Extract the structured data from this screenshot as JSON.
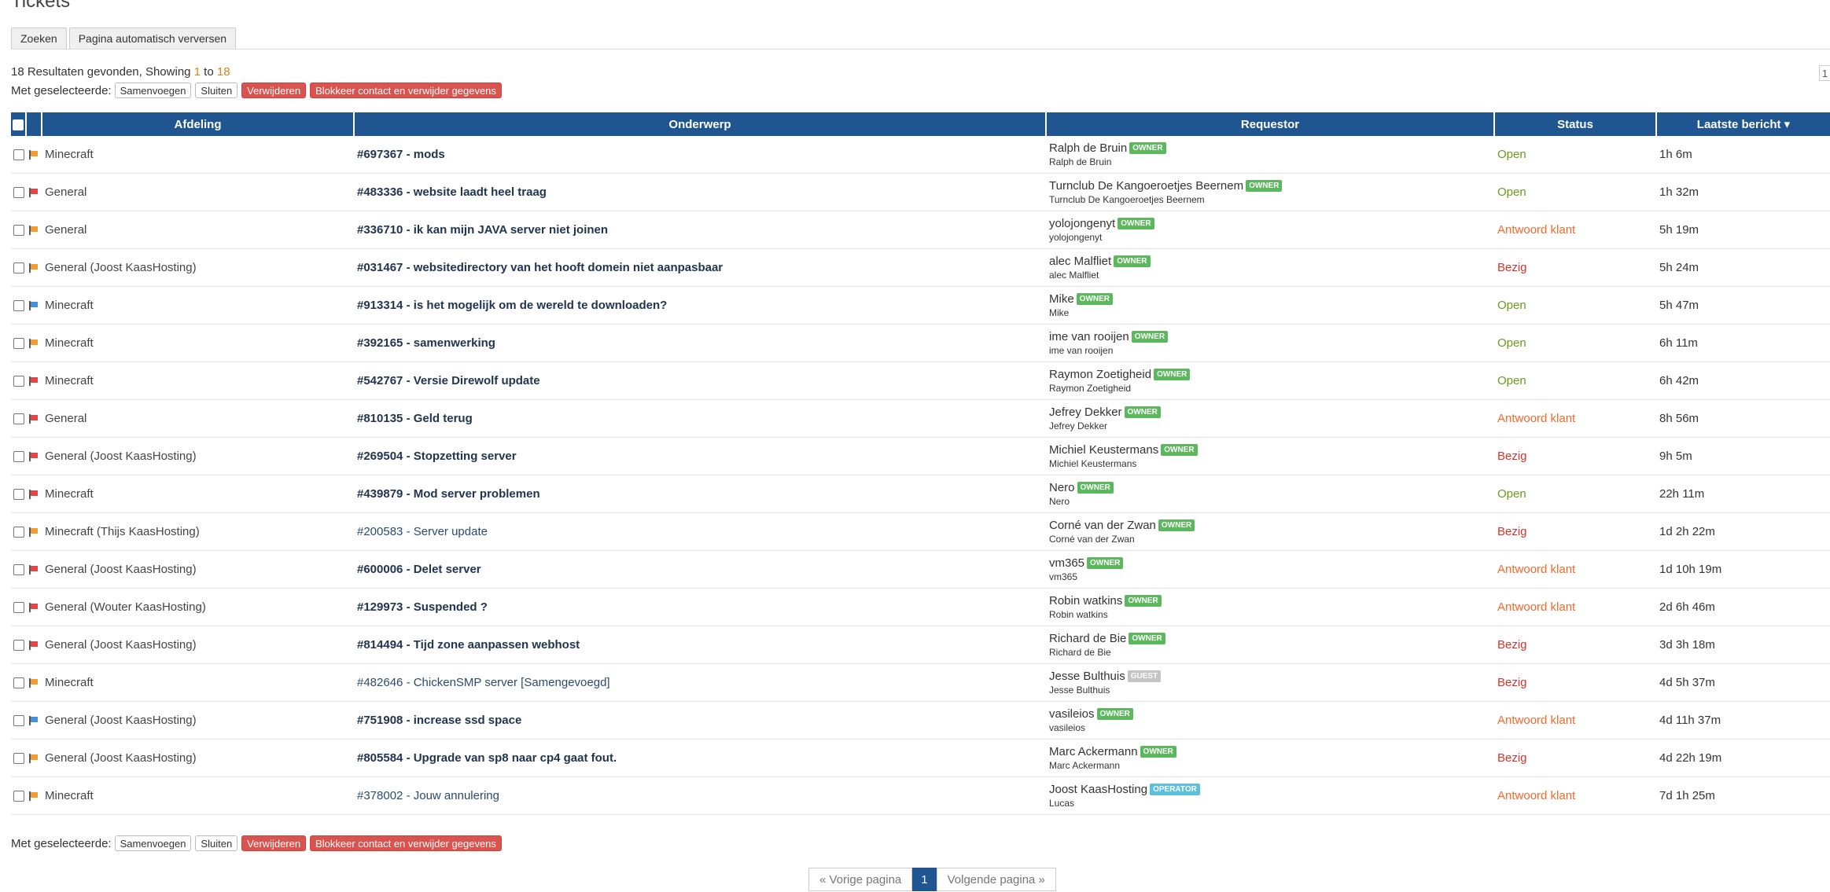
{
  "page": {
    "title": "Tickets"
  },
  "tabs": [
    {
      "label": "Zoeken"
    },
    {
      "label": "Pagina automatisch verversen"
    }
  ],
  "results": {
    "prefix": "18 Resultaten gevonden, Showing ",
    "from": "1",
    "mid": " to ",
    "to": "18"
  },
  "bulk": {
    "label": "Met geselecteerde:",
    "merge": "Samenvoegen",
    "close": "Sluiten",
    "delete": "Verwijderen",
    "block": "Blokkeer contact en verwijder gegevens"
  },
  "top_page_indicator": "1",
  "table": {
    "headers": {
      "department": "Afdeling",
      "subject": "Onderwerp",
      "requestor": "Requestor",
      "status": "Status",
      "last": "Laatste bericht ▾"
    },
    "rows": [
      {
        "flag": "orange",
        "department": "Minecraft",
        "subject": "#697367 - mods",
        "bold": true,
        "name": "Ralph de Bruin",
        "role": "OWNER",
        "sub": "Ralph de Bruin",
        "status": "Open",
        "last": "1h 6m"
      },
      {
        "flag": "red",
        "department": "General",
        "subject": "#483336 - website laadt heel traag",
        "bold": true,
        "name": "Turnclub De Kangoeroetjes Beernem",
        "role": "OWNER",
        "sub": "Turnclub De Kangoeroetjes Beernem",
        "status": "Open",
        "last": "1h 32m"
      },
      {
        "flag": "orange",
        "department": "General",
        "subject": "#336710 - ik kan mijn JAVA server niet joinen",
        "bold": true,
        "name": "yolojongenyt",
        "role": "OWNER",
        "sub": "yolojongenyt",
        "status": "Antwoord klant",
        "last": "5h 19m"
      },
      {
        "flag": "orange",
        "department": "General (Joost KaasHosting)",
        "subject": "#031467 - websitedirectory van het hooft domein niet aanpasbaar",
        "bold": true,
        "name": "alec Malfliet",
        "role": "OWNER",
        "sub": "alec Malfliet",
        "status": "Bezig",
        "last": "5h 24m"
      },
      {
        "flag": "blue",
        "department": "Minecraft",
        "subject": "#913314 - is het mogelijk om de wereld te downloaden?",
        "bold": true,
        "name": "Mike",
        "role": "OWNER",
        "sub": "Mike",
        "status": "Open",
        "last": "5h 47m"
      },
      {
        "flag": "orange",
        "department": "Minecraft",
        "subject": "#392165 - samenwerking",
        "bold": true,
        "name": "ime van rooijen",
        "role": "OWNER",
        "sub": "ime van rooijen",
        "status": "Open",
        "last": "6h 11m"
      },
      {
        "flag": "red",
        "department": "Minecraft",
        "subject": "#542767 - Versie Direwolf update",
        "bold": true,
        "name": "Raymon Zoetigheid",
        "role": "OWNER",
        "sub": "Raymon Zoetigheid",
        "status": "Open",
        "last": "6h 42m"
      },
      {
        "flag": "red",
        "department": "General",
        "subject": "#810135 - Geld terug",
        "bold": true,
        "name": "Jefrey Dekker",
        "role": "OWNER",
        "sub": "Jefrey Dekker",
        "status": "Antwoord klant",
        "last": "8h 56m"
      },
      {
        "flag": "red",
        "department": "General (Joost KaasHosting)",
        "subject": "#269504 - Stopzetting server",
        "bold": true,
        "name": "Michiel Keustermans",
        "role": "OWNER",
        "sub": "Michiel Keustermans",
        "status": "Bezig",
        "last": "9h 5m"
      },
      {
        "flag": "red",
        "department": "Minecraft",
        "subject": "#439879 - Mod server problemen",
        "bold": true,
        "name": "Nero",
        "role": "OWNER",
        "sub": "Nero",
        "status": "Open",
        "last": "22h 11m"
      },
      {
        "flag": "orange",
        "department": "Minecraft (Thijs KaasHosting)",
        "subject": "#200583 - Server update",
        "bold": false,
        "name": "Corné van der Zwan",
        "role": "OWNER",
        "sub": "Corné van der Zwan",
        "status": "Bezig",
        "last": "1d 2h 22m"
      },
      {
        "flag": "red",
        "department": "General (Joost KaasHosting)",
        "subject": "#600006 - Delet server",
        "bold": true,
        "name": "vm365",
        "role": "OWNER",
        "sub": "vm365",
        "status": "Antwoord klant",
        "last": "1d 10h 19m"
      },
      {
        "flag": "red",
        "department": "General (Wouter KaasHosting)",
        "subject": "#129973 - Suspended ?",
        "bold": true,
        "name": "Robin watkins",
        "role": "OWNER",
        "sub": "Robin watkins",
        "status": "Antwoord klant",
        "last": "2d 6h 46m"
      },
      {
        "flag": "red",
        "department": "General (Joost KaasHosting)",
        "subject": "#814494 - Tijd zone aanpassen webhost",
        "bold": true,
        "name": "Richard de Bie",
        "role": "OWNER",
        "sub": "Richard de Bie",
        "status": "Bezig",
        "last": "3d 3h 18m"
      },
      {
        "flag": "orange",
        "department": "Minecraft",
        "subject": "#482646 - ChickenSMP server [Samengevoegd]",
        "bold": false,
        "name": "Jesse Bulthuis",
        "role": "GUEST",
        "sub": "Jesse Bulthuis",
        "status": "Bezig",
        "last": "4d 5h 37m"
      },
      {
        "flag": "blue",
        "department": "General (Joost KaasHosting)",
        "subject": "#751908 - increase ssd space",
        "bold": true,
        "name": "vasileios",
        "role": "OWNER",
        "sub": "vasileios",
        "status": "Antwoord klant",
        "last": "4d 11h 37m"
      },
      {
        "flag": "orange",
        "department": "General (Joost KaasHosting)",
        "subject": "#805584 - Upgrade van sp8 naar cp4 gaat fout.",
        "bold": true,
        "name": "Marc Ackermann",
        "role": "OWNER",
        "sub": "Marc Ackermann",
        "status": "Bezig",
        "last": "4d 22h 19m"
      },
      {
        "flag": "orange",
        "department": "Minecraft",
        "subject": "#378002 - Jouw annulering",
        "bold": false,
        "name": "Joost KaasHosting",
        "role": "OPERATOR",
        "sub": "Lucas",
        "status": "Antwoord klant",
        "last": "7d 1h 25m"
      }
    ]
  },
  "colors": {
    "header_bg": "#1f5590",
    "flag_orange": "#f0a033",
    "flag_red": "#e34848",
    "flag_blue": "#4a8fd6",
    "role_owner": "#5cb85c",
    "role_guest": "#c4c4c4",
    "role_operator": "#5bc0de",
    "status_open": "#6b9a1a",
    "status_antwoord": "#f26a2a",
    "status_bezig": "#d9342b"
  },
  "pager": {
    "prev": "« Vorige pagina",
    "current": "1",
    "next": "Volgende pagina »"
  }
}
